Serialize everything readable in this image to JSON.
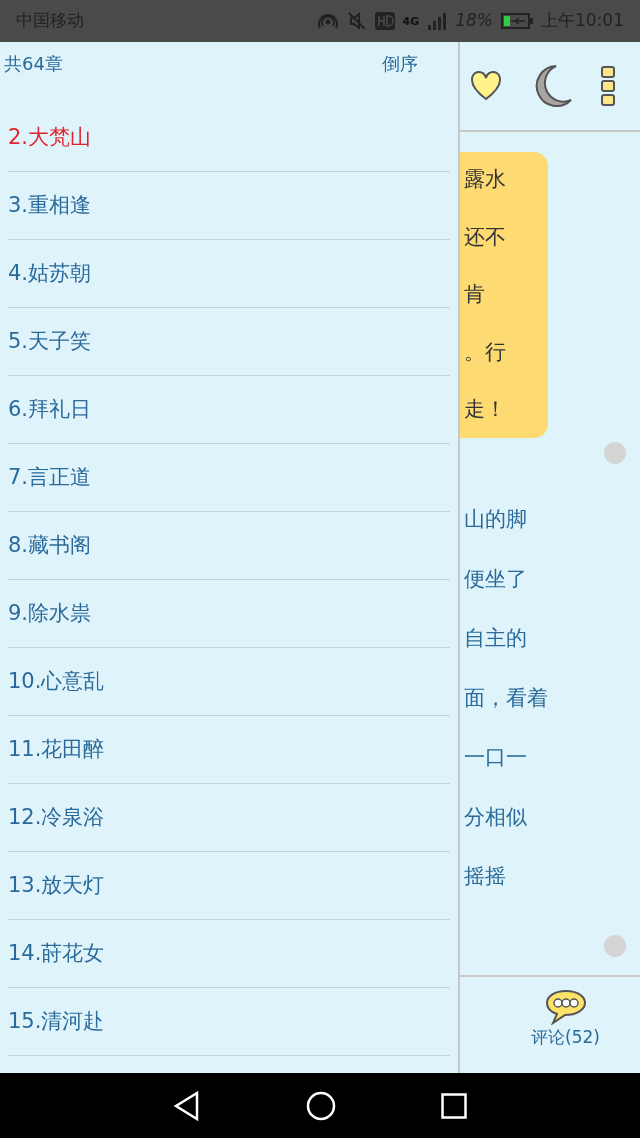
{
  "status_bar": {
    "carrier": "中国移动",
    "network": "4G",
    "battery_percent": "18%",
    "time": "上午10:01"
  },
  "drawer": {
    "count": "共64章",
    "sort": "倒序",
    "chapters": [
      {
        "title": "2.大梵山",
        "selected": true
      },
      {
        "title": "3.重相逢",
        "selected": false
      },
      {
        "title": "4.姑苏朝",
        "selected": false
      },
      {
        "title": "5.天子笑",
        "selected": false
      },
      {
        "title": "6.拜礼日",
        "selected": false
      },
      {
        "title": "7.言正道",
        "selected": false
      },
      {
        "title": "8.藏书阁",
        "selected": false
      },
      {
        "title": "9.除水祟",
        "selected": false
      },
      {
        "title": "10.心意乱",
        "selected": false
      },
      {
        "title": "11.花田醉",
        "selected": false
      },
      {
        "title": "12.冷泉浴",
        "selected": false
      },
      {
        "title": "13.放天灯",
        "selected": false
      },
      {
        "title": "14.莳花女",
        "selected": false
      },
      {
        "title": "15.清河赴",
        "selected": false
      }
    ]
  },
  "reader": {
    "bubble_lines": [
      "露水",
      "还不",
      "肯",
      "。行",
      "走！"
    ],
    "body_lines": [
      "山的脚",
      "便坐了",
      "自主的",
      "面，看着",
      "一口一",
      "分相似",
      "摇摇"
    ],
    "comments": "评论(52)"
  }
}
